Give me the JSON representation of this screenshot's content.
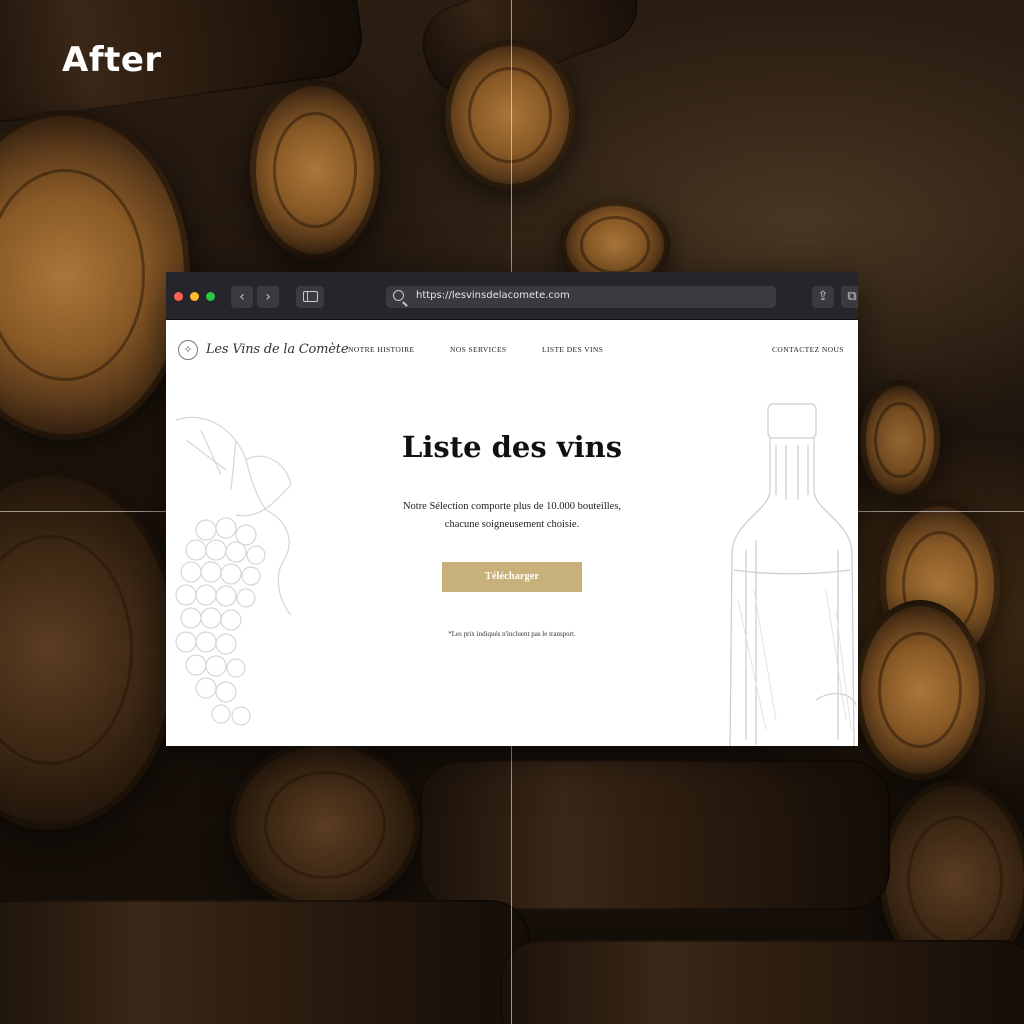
{
  "overlay": {
    "label": "After"
  },
  "browser": {
    "url": "https://lesvinsdelacomete.com",
    "back_glyph": "‹",
    "forward_glyph": "›",
    "share_glyph": "⇪",
    "tabs_glyph": "⧉"
  },
  "site": {
    "logo_mark": "✧",
    "logo_text": "Les Vins de la Comète",
    "nav": {
      "histoire": "NOTRE HISTOIRE",
      "services": "NOS SERVICES",
      "liste": "LISTE DES VINS",
      "contact": "CONTACTEZ NOUS"
    }
  },
  "hero": {
    "title": "Liste des vins",
    "description": "Notre Sélection comporte plus de 10.000 bouteilles, chacune soigneusement choisie.",
    "cta_label": "Télécharger",
    "footnote": "*Les prix indiqués n'incluent pas le transport."
  },
  "colors": {
    "accent_gold": "#c7b07a",
    "browser_chrome": "#26262a"
  }
}
